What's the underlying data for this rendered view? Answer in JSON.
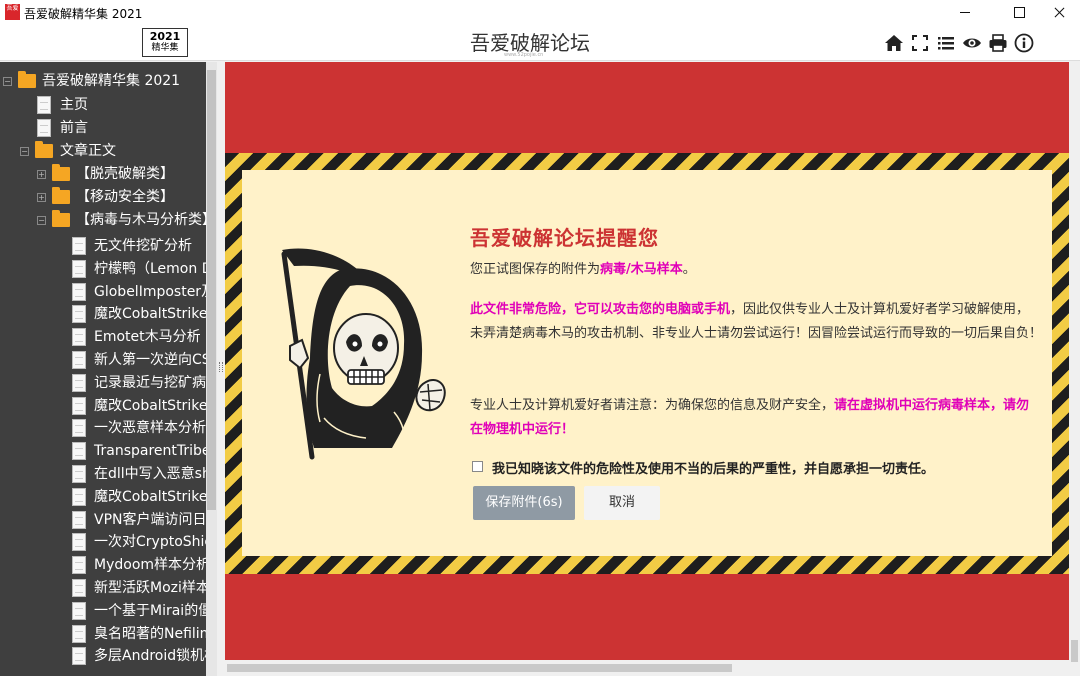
{
  "window": {
    "title": "吾爱破解精华集 2021",
    "icon_text": "吾爱"
  },
  "header": {
    "logo_year": "2021",
    "logo_sub": "精华集",
    "site_title": "吾爱破解论坛",
    "site_url": "www.52pojie.cn",
    "toolbar_icons": [
      "home-icon",
      "fullscreen-icon",
      "list-icon",
      "eye-icon",
      "print-icon",
      "info-icon"
    ]
  },
  "sidebar": {
    "root": "吾爱破解精华集 2021",
    "items": [
      {
        "label": "主页",
        "type": "doc"
      },
      {
        "label": "前言",
        "type": "doc"
      },
      {
        "label": "文章正文",
        "type": "folder"
      },
      {
        "label": "【脱壳破解类】",
        "type": "folder"
      },
      {
        "label": "【移动安全类】",
        "type": "folder"
      },
      {
        "label": "【病毒与木马分析类】",
        "type": "folder"
      }
    ],
    "articles": [
      "无文件挖矿分析",
      "柠檬鸭（Lemon D",
      "GlobelImposter及",
      "魔改CobaltStrike",
      "Emotet木马分析",
      "新人第一次逆向CS",
      "记录最近与挖矿病毒",
      "魔改CobaltStrike",
      "一次恶意样本分析",
      "TransparentTribe",
      "在dll中写入恶意sh",
      "魔改CobaltStrike",
      "VPN客户端访问日志",
      "一次对CryptoShie",
      "Mydoom样本分析",
      "新型活跃Mozi样本",
      "一个基于Mirai的僵",
      "臭名昭著的Nefilim",
      "多层Android锁机样"
    ]
  },
  "notice": {
    "title": "吾爱破解论坛提醒您",
    "p1_prefix": "您正试图保存的附件为",
    "p1_highlight": "病毒/木马样本",
    "p1_suffix": "。",
    "p2_highlight": "此文件非常危险，它可以攻击您的电脑或手机",
    "p2_text": "，因此仅供专业人士及计算机爱好者学习破解使用，未弄清楚病毒木马的攻击机制、非专业人士请勿尝试运行！因冒险尝试运行而导致的一切后果自负！",
    "p3_text": "专业人士及计算机爱好者请注意：为确保您的信息及财产安全，",
    "p3_highlight": "请在虚拟机中运行病毒样本，请勿在物理机中运行！",
    "confirm_text": "我已知晓该文件的危险性及使用不当的后果的严重性，并自愿承担一切责任。",
    "confirm_checked": false,
    "save_button": "保存附件(6s)",
    "cancel_button": "取消"
  },
  "colors": {
    "banner_red": "#cc3333",
    "notice_bg": "#fff2c9",
    "highlight": "#e000b8",
    "hazard_yellow": "#f2cc45",
    "sidebar_bg": "#3f3f3f"
  }
}
